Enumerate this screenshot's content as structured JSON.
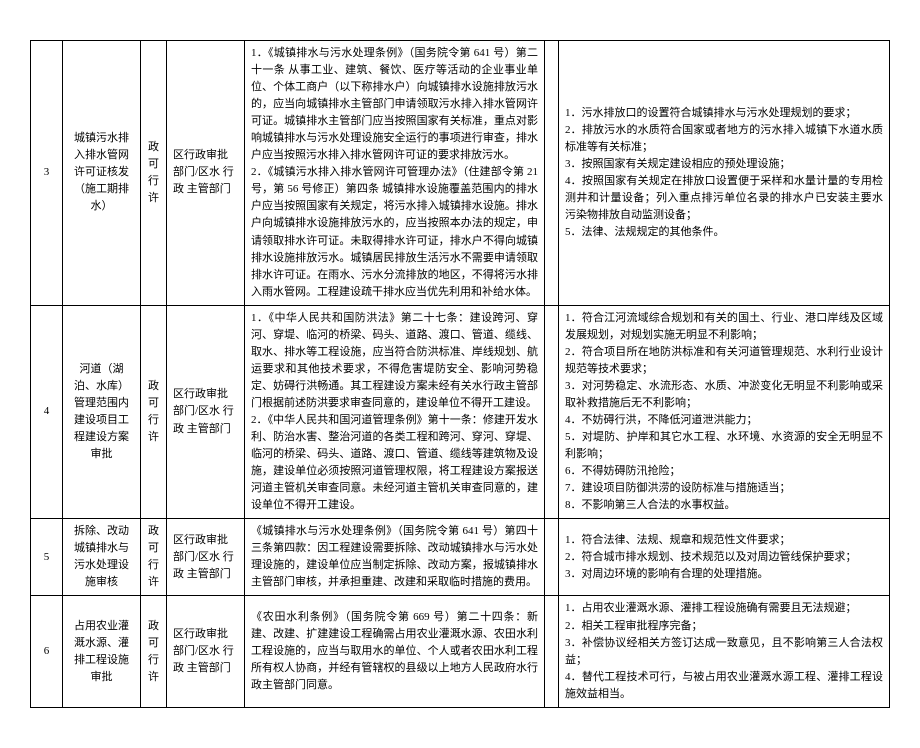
{
  "rows": [
    {
      "num": "3",
      "item": "城镇污水排入排水管网许可证核发（施工期排水）",
      "type": "政可行许",
      "dept": "区行政审批部门/区水 行 政 主管部门",
      "basis": "1．《城镇排水与污水处理条例》（国务院令第 641 号）第二十一条 从事工业、建筑、餐饮、医疗等活动的企业事业单位、个体工商户（以下称排水户）向城镇排水设施排放污水的，应当向城镇排水主管部门申请领取污水排入排水管网许可证。城镇排水主管部门应当按照国家有关标准，重点对影响城镇排水与污水处理设施安全运行的事项进行审查，排水户应当按照污水排入排水管网许可证的要求排放污水。\n2．《城镇污水排入排水管网许可管理办法》（住建部令第 21 号，第 56 号修正）第四条 城镇排水设施覆盖范围内的排水户应当按照国家有关规定，将污水排入城镇排水设施。排水户向城镇排水设施排放污水的，应当按照本办法的规定，申请领取排水许可证。未取得排水许可证，排水户不得向城镇排水设施排放污水。城镇居民排放生活污水不需要申请领取排水许可证。在雨水、污水分流排放的地区，不得将污水排入雨水管网。工程建设疏干排水应当优先利用和补给水体。",
      "cond": "1．污水排放口的设置符合城镇排水与污水处理规划的要求；\n2．排放污水的水质符合国家或者地方的污水排入城镇下水道水质标准等有关标准；\n3．按照国家有关规定建设相应的预处理设施；\n4．按照国家有关规定在排放口设置便于采样和水量计量的专用检测井和计量设备；列入重点排污单位名录的排水户已安装主要水污染物排放自动监测设备；\n5．法律、法规规定的其他条件。"
    },
    {
      "num": "4",
      "item": "河道（湖泊、水库）管理范围内建设项目工程建设方案审批",
      "type": "政可行许",
      "dept": "区行政审批部门/区水 行 政 主管部门",
      "basis": "1．《中华人民共和国防洪法》第二十七条：建设跨河、穿河、穿堤、临河的桥梁、码头、道路、渡口、管道、缆线、取水、排水等工程设施，应当符合防洪标准、岸线规划、航运要求和其他技术要求，不得危害堤防安全、影响河势稳定、妨碍行洪畅通。其工程建设方案未经有关水行政主管部门根据前述防洪要求审查同意的，建设单位不得开工建设。\n2．《中华人民共和国河道管理条例》第十一条：修建开发水利、防治水害、整治河道的各类工程和跨河、穿河、穿堤、临河的桥梁、码头、道路、渡口、管道、缆线等建筑物及设施，建设单位必须按照河道管理权限，将工程建设方案报送河道主管机关审查同意。未经河道主管机关审查同意的，建设单位不得开工建设。",
      "cond": "1．符合江河流域综合规划和有关的国土、行业、港口岸线及区域发展规划，对规划实施无明显不利影响；\n2．符合项目所在地防洪标准和有关河道管理规范、水利行业设计规范等技术要求；\n3．对河势稳定、水流形态、水质、冲淤变化无明显不利影响或采取补救措施后无不利影响；\n4．不妨碍行洪，不降低河道泄洪能力；\n5．对堤防、护岸和其它水工程、水环境、水资源的安全无明显不利影响；\n6．不得妨碍防汛抢险；\n7．建设项目防御洪涝的设防标准与措施适当；\n8．不影响第三人合法的水事权益。"
    },
    {
      "num": "5",
      "item": "拆除、改动城镇排水与污水处理设施审核",
      "type": "政可行许",
      "dept": "区行政审批部门/区水 行 政 主管部门",
      "basis": "《城镇排水与污水处理条例》（国务院令第 641 号）第四十三条第四款：因工程建设需要拆除、改动城镇排水与污水处理设施的，建设单位应当制定拆除、改动方案，报城镇排水主管部门审核，并承担重建、改建和采取临时措施的费用。",
      "cond": "1．符合法律、法规、规章和规范性文件要求；\n2．符合城市排水规划、技术规范以及对周边管线保护要求；\n3．对周边环境的影响有合理的处理措施。"
    },
    {
      "num": "6",
      "item": "占用农业灌溉水源、灌排工程设施审批",
      "type": "政可行许",
      "dept": "区行政审批部门/区水 行 政 主管部门",
      "basis": "《农田水利条例》（国务院令第 669 号）第二十四条：新建、改建、扩建建设工程确需占用农业灌溉水源、农田水利工程设施的，应当与取用水的单位、个人或者农田水利工程所有权人协商，并经有管辖权的县级以上地方人民政府水行政主管部门同意。",
      "cond": "1．占用农业灌溉水源、灌排工程设施确有需要且无法规避；\n2．相关工程审批程序完备；\n3．补偿协议经相关方签订达成一致意见，且不影响第三人合法权益；\n4．替代工程技术可行，与被占用农业灌溉水源工程、灌排工程设施效益相当。"
    }
  ]
}
